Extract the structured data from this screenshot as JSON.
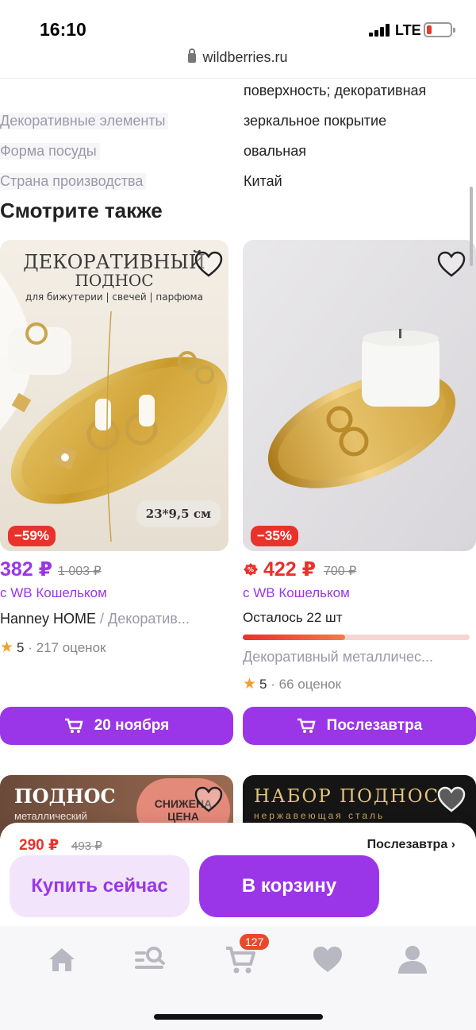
{
  "status": {
    "time": "16:10",
    "network": "LTE"
  },
  "url": "wildberries.ru",
  "specs": {
    "partial_value": "поверхность; декоративная",
    "rows": [
      {
        "label": "Декоративные элементы",
        "value": "зеркальное покрытие"
      },
      {
        "label": "Форма посуды",
        "value": "овальная"
      },
      {
        "label": "Страна производства",
        "value": "Китай"
      }
    ]
  },
  "section_title": "Смотрите также",
  "products": [
    {
      "image_title_1": "ДЕКОРАТИВНЫЙ",
      "image_title_2": "ПОДНОС",
      "image_subtitle": "для бижутерии | свечей | парфюма",
      "size_label": "23*9,5 см",
      "discount": "−59%",
      "price": "382 ₽",
      "old_price": "1 003 ₽",
      "wallet_label": "с WB Кошельком",
      "brand": "Hanney HOME",
      "category": " / Декоратив...",
      "rating": "5",
      "reviews": "· 217 оценок",
      "delivery": "20 ноября"
    },
    {
      "discount": "−35%",
      "price": "422 ₽",
      "old_price": "700 ₽",
      "wallet_label": "с WB Кошельком",
      "stock": "Осталось 22 шт",
      "stock_fraction": 0.45,
      "name": "Декоративный металличес...",
      "rating": "5",
      "reviews": "· 66 оценок",
      "delivery": "Послезавтра"
    }
  ],
  "thumbs": [
    {
      "title": "ПОДНОС",
      "subtitle": "металлический",
      "sticker": "СНИЖЕНА ЦЕНА"
    },
    {
      "title": "НАБОР ПОДНОС",
      "subtitle": "нержавеющая сталь"
    }
  ],
  "sheet": {
    "price": "290 ₽",
    "old_price": "493 ₽",
    "delivery": "Послезавтра ›",
    "buy_now": "Купить сейчас",
    "add_cart": "В корзину"
  },
  "tabbar": {
    "cart_count": "127",
    "items": [
      "home-icon",
      "catalog-search-icon",
      "cart-icon",
      "favorites-icon",
      "profile-icon"
    ]
  },
  "colors": {
    "accent": "#9b36e8",
    "sale": "#e8322b"
  }
}
